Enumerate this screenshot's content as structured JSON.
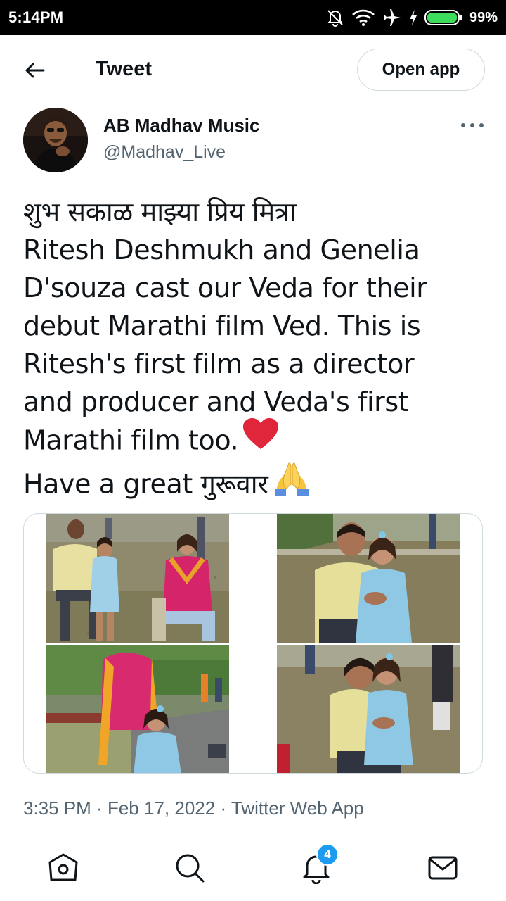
{
  "status_bar": {
    "time": "5:14PM",
    "battery_percent": "99%",
    "icons": [
      "mute-bell-icon",
      "wifi-icon",
      "airplane-icon",
      "charging-bolt-icon",
      "battery-icon"
    ]
  },
  "header": {
    "back_icon": "arrow-left-icon",
    "title": "Tweet",
    "open_app_label": "Open app"
  },
  "tweet": {
    "author": {
      "name": "AB Madhav Music",
      "handle": "@Madhav_Live"
    },
    "more_icon": "more-dots-icon",
    "text_lines": [
      "शुभ सकाळ माझ्या प्रिय मित्रा",
      "Ritesh Deshmukh and Genelia",
      "D'souza cast our Veda for their",
      "debut Marathi film Ved. This is",
      "Ritesh's first film as a director",
      "and producer and Veda's first",
      "Marathi film too.",
      "Have a great गुरूवार"
    ],
    "emojis": [
      "red-heart-emoji",
      "folded-hands-emoji"
    ],
    "media": {
      "photo_count": 4,
      "photos": [
        "photo-family-seated",
        "photo-father-daughter",
        "photo-mother-daughter",
        "photo-kiss-daughter"
      ]
    },
    "meta": {
      "time": "3:35 PM",
      "date": "Feb 17, 2022",
      "source": "Twitter Web App",
      "separator": "·"
    }
  },
  "bottom_nav": {
    "items": [
      "home-icon",
      "search-icon",
      "notifications-icon",
      "messages-icon"
    ],
    "notification_count": "4"
  },
  "colors": {
    "text_primary": "#0f1419",
    "text_secondary": "#536471",
    "border": "#cfd9de",
    "accent": "#1d9bf0",
    "heart": "#e0263a"
  }
}
